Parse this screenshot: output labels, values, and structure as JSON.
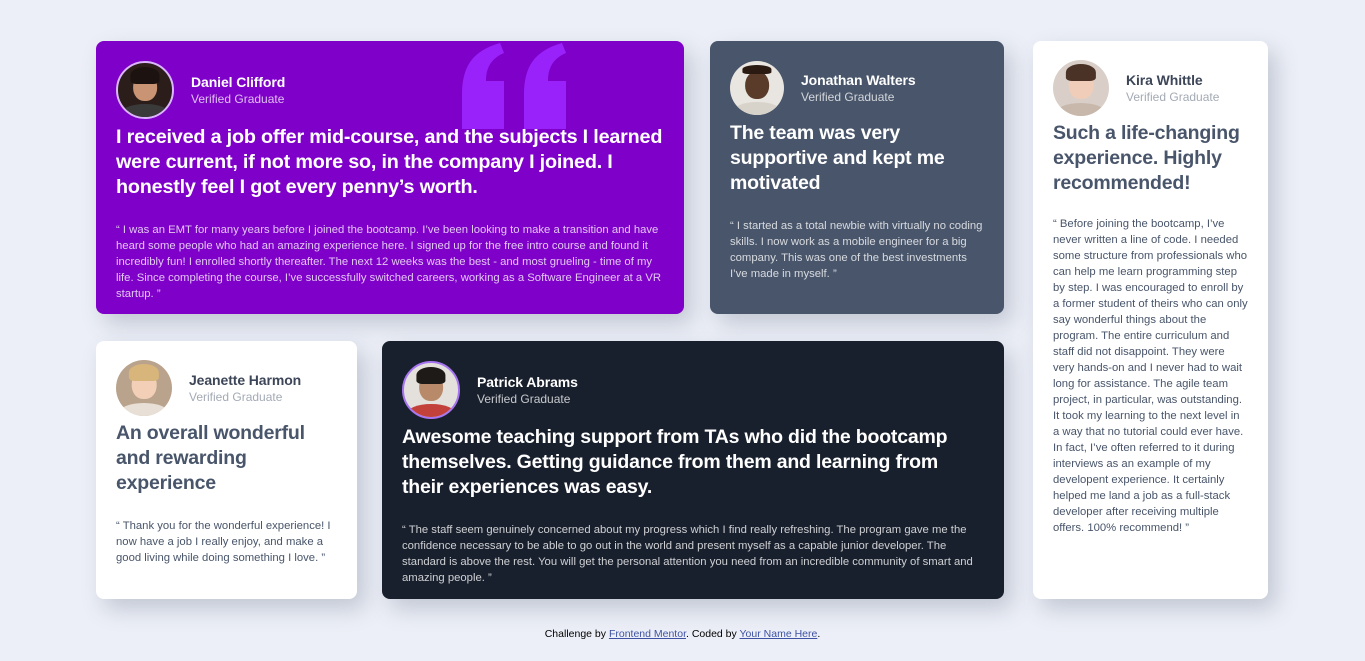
{
  "testimonials": {
    "daniel": {
      "name": "Daniel Clifford",
      "role": "Verified Graduate",
      "headline": "I received a job offer mid-course, and the subjects I learned were current, if not more so, in the company I joined. I honestly feel I got every penny’s worth.",
      "body": "“ I was an EMT for many years before I joined the bootcamp. I’ve been looking to make a transition and have heard some people who had an amazing experience here. I signed up for the free intro course and found it incredibly fun! I enrolled shortly thereafter. The next 12 weeks was the best - and most grueling - time of my life. Since completing the course, I’ve successfully switched careers, working as a Software Engineer at a VR startup. ”"
    },
    "jonathan": {
      "name": "Jonathan Walters",
      "role": "Verified Graduate",
      "headline": "The team was very supportive and kept me motivated",
      "body": "“ I started as a total newbie with virtually no coding skills. I now work as a mobile engineer for a big company. This was one of the best investments I’ve made in myself. ”"
    },
    "kira": {
      "name": "Kira Whittle",
      "role": "Verified Graduate",
      "headline": "Such a life-changing experience. Highly recommended!",
      "body": "“ Before joining the bootcamp, I’ve never written a line of code. I needed some structure from professionals who can help me learn programming step by step. I was encouraged to enroll by a former student of theirs who can only say wonderful things about the program. The entire curriculum and staff did not disappoint. They were very hands-on and I never had to wait long for assistance. The agile team project, in particular, was outstanding. It took my learning to the next level in a way that no tutorial could ever have. In fact, I’ve often referred to it during interviews as an example of my developent experience. It certainly helped me land a job as a full-stack developer after receiving multiple offers. 100% recommend! ”"
    },
    "jeanette": {
      "name": "Jeanette Harmon",
      "role": "Verified Graduate",
      "headline": "An overall wonderful and rewarding experience",
      "body": "“ Thank you for the wonderful experience! I now have a job I really enjoy, and make a good living while doing something I love. ”"
    },
    "patrick": {
      "name": "Patrick Abrams",
      "role": "Verified Graduate",
      "headline": "Awesome teaching support from TAs who did the bootcamp themselves. Getting guidance from them and learning from their experiences was easy.",
      "body": "“ The staff seem genuinely concerned about my progress which I find really refreshing. The program gave me the confidence necessary to be able to go out in the world and present myself as a capable junior developer. The standard is above the rest. You will get the personal attention you need from an incredible community of smart and amazing people. ”"
    }
  },
  "footer": {
    "prefix": "Challenge by",
    "link1": "Frontend Mentor",
    "middle": ". Coded by",
    "link2": "Your Name Here",
    "suffix": "."
  },
  "colors": {
    "background": "#eceff7",
    "moderate_violet": "#7f00c9",
    "grayish_blue": "#48556a",
    "very_dark_blackish_blue": "#19202d",
    "white": "#ffffff"
  }
}
